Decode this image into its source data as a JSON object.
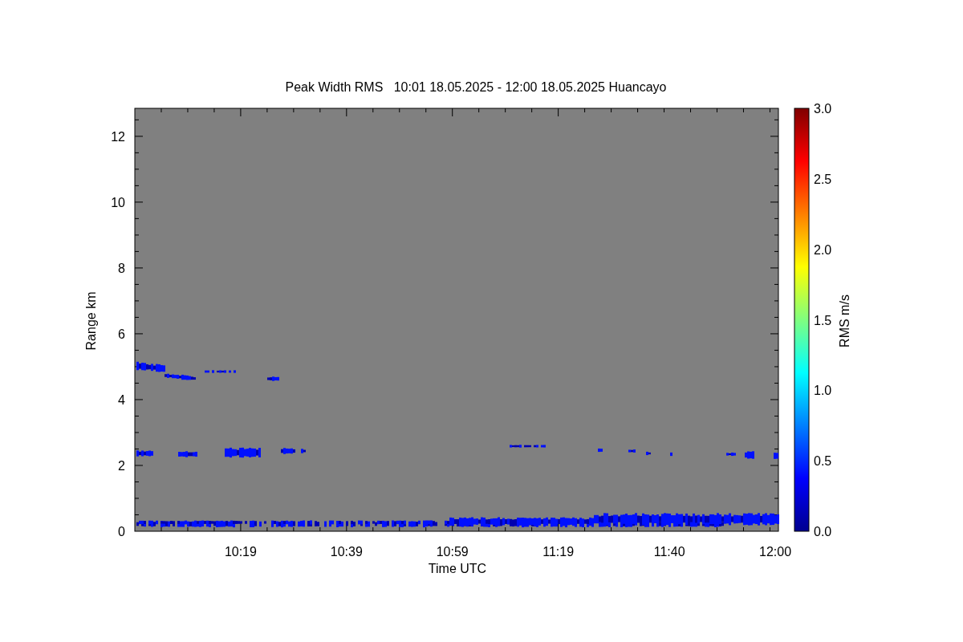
{
  "chart": {
    "chart_data": {
      "type": "scatter",
      "title": "Peak Width RMS   10:01 18.05.2025 - 12:00 18.05.2025 Huancayo",
      "xlabel": "Time UTC",
      "ylabel": "Range km",
      "xlim": [
        599,
        720.6
      ],
      "ylim": [
        0,
        12.85
      ],
      "xticks": [
        {
          "value": 619,
          "label": "10:19"
        },
        {
          "value": 639,
          "label": "10:39"
        },
        {
          "value": 659,
          "label": "10:59"
        },
        {
          "value": 679,
          "label": "11:19"
        },
        {
          "value": 700,
          "label": "11:40"
        },
        {
          "value": 720,
          "label": "12:00"
        }
      ],
      "yticks": [
        0,
        2,
        4,
        6,
        8,
        10,
        12
      ]
    },
    "colorbar": {
      "label": "RMS m/s",
      "ticks": [
        "3.0",
        "2.5",
        "2.0",
        "1.5",
        "1.0",
        "0.5",
        "0.0"
      ]
    }
  }
}
